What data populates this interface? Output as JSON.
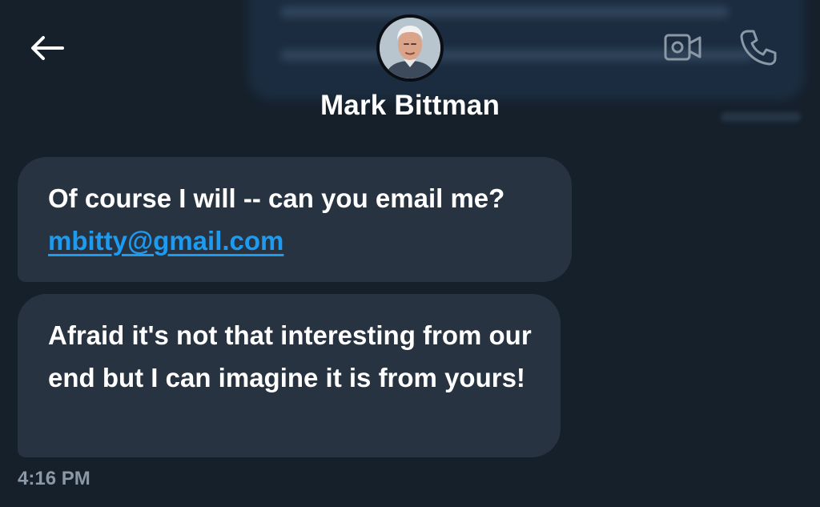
{
  "header": {
    "back_icon": "arrow-left-icon",
    "contact_name": "Mark Bittman",
    "video_icon": "video-camera-icon",
    "call_icon": "phone-icon"
  },
  "messages": [
    {
      "text_before": "Of course I will -- can you email me?",
      "link": "mbitty@gmail.com"
    },
    {
      "text": "Afraid it's not that interesting from our end but I can imagine it is from yours!"
    }
  ],
  "timestamp": "4:16 PM",
  "colors": {
    "background": "#15202b",
    "bubble": "#273340",
    "link": "#1d9bf0",
    "muted": "#8b98a5"
  }
}
